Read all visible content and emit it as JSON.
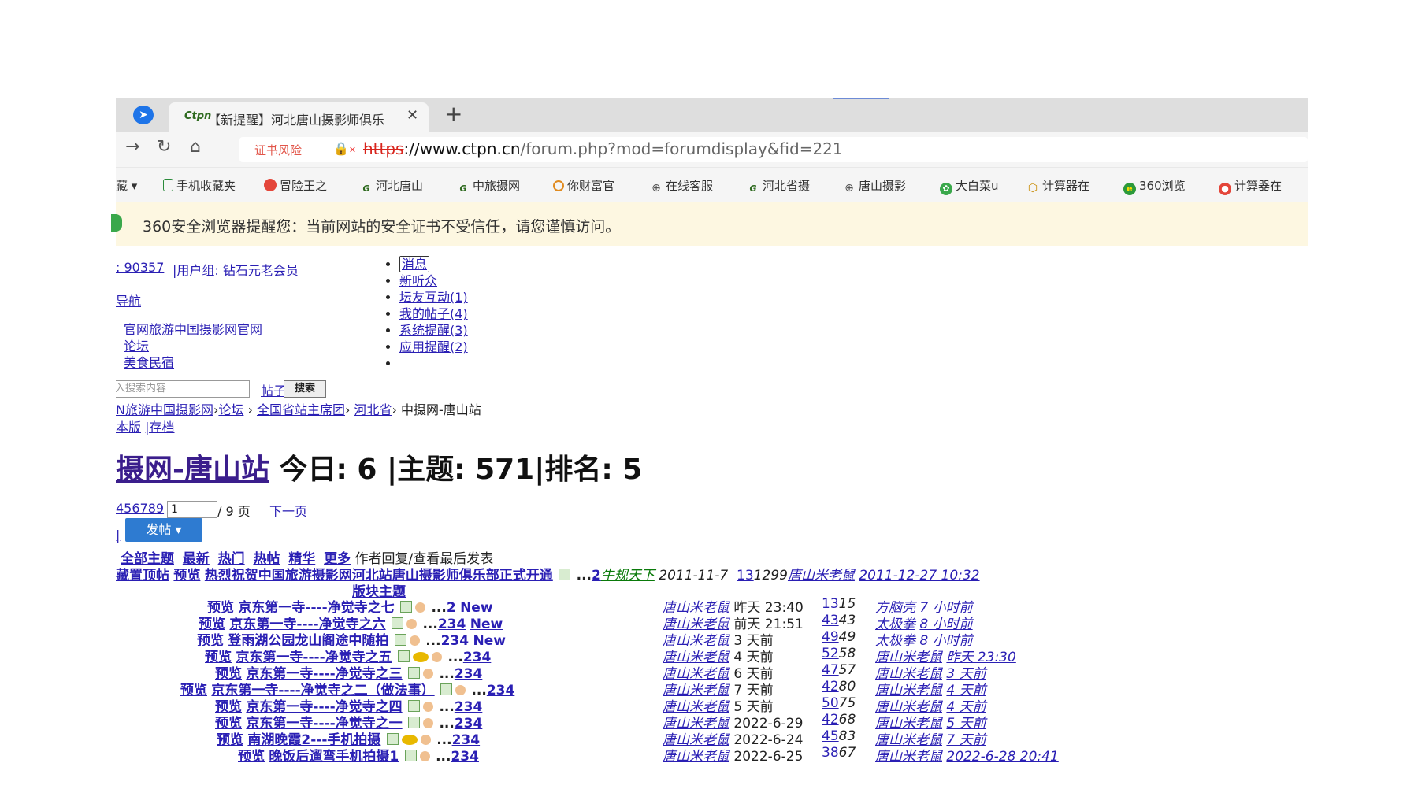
{
  "browser": {
    "tab": {
      "title": "【新提醒】河北唐山摄影师俱乐",
      "favicon": "Ctpn"
    },
    "address": {
      "cert_warning": "证书风险",
      "scheme": "https",
      "host": "://www.ctpn.cn",
      "path": "/forum.php?mod=forumdisplay&fid=221"
    },
    "bookmarks": [
      {
        "label": "藏",
        "icon": "none"
      },
      {
        "label": "手机收藏夹",
        "icon": "phone-icon"
      },
      {
        "label": "冒险王之",
        "icon": "pin-icon"
      },
      {
        "label": "河北唐山",
        "icon": "ctpn-icon"
      },
      {
        "label": "中旅摄网",
        "icon": "ctpn-icon"
      },
      {
        "label": "你财富官",
        "icon": "circle-icon"
      },
      {
        "label": "在线客服",
        "icon": "globe-icon"
      },
      {
        "label": "河北省摄",
        "icon": "ctpn-icon"
      },
      {
        "label": "唐山摄影",
        "icon": "globe-icon"
      },
      {
        "label": "大白菜u",
        "icon": "leaf-icon"
      },
      {
        "label": "计算器在",
        "icon": "hex-icon"
      },
      {
        "label": "360浏览",
        "icon": "360-icon"
      },
      {
        "label": "计算器在",
        "icon": "apple-icon"
      }
    ],
    "security_warning": "360安全浏览器提醒您：当前网站的安全证书不受信任，请您谨慎访问。"
  },
  "user": {
    "id_fragment": ": 90357",
    "group": "|用户组: 钻石元老会员",
    "nav": "导航",
    "links": [
      "官网旅游中国摄影网官网",
      "论坛",
      "美食民宿"
    ]
  },
  "messages": {
    "items": [
      "消息",
      "新听众",
      "坛友互动(1)",
      "我的帖子(4)",
      "系统提醒(3)",
      "应用提醒(2)",
      ""
    ]
  },
  "search": {
    "placeholder": "入搜索内容",
    "scope": "帖子",
    "button": "搜索"
  },
  "breadcrumb": {
    "items": [
      "N旅游中国摄影网",
      "论坛",
      "全国省站主席团",
      "河北省"
    ],
    "current": "中摄网-唐山站",
    "modes": [
      "本版",
      "|存档"
    ]
  },
  "forum": {
    "name": "摄网-唐山站",
    "stats": " 今日: 6 |主题: 571|排名: 5"
  },
  "pager": {
    "pages": "456789",
    "current": "1",
    "total": " / 9 页",
    "next": "下一页"
  },
  "post_button": "发帖",
  "filters": {
    "items": [
      "全部主题",
      "最新",
      "热门",
      "热帖",
      "精华",
      "更多"
    ],
    "columns": "作者回复/查看最后发表"
  },
  "sticky": {
    "prefix": "藏置顶帖",
    "preview": "预览",
    "title": "热烈祝贺中国旅游摄影网河北站唐山摄影师俱乐部正式开通",
    "pages": "2",
    "author": "牛规天下",
    "date": "2011-11-7",
    "replies": "13",
    "views": "1299",
    "last_author": "唐山米老鼠",
    "last_time": "2011-12-27 10:32"
  },
  "section_label": "版块主题",
  "threads": [
    {
      "preview": "预览",
      "title": "京东第一寺----净觉寺之七",
      "pages": "2",
      "new": "New",
      "author": "唐山米老鼠",
      "time": "昨天 23:40",
      "replies": "13",
      "views": "15",
      "last_author": "方脑壳",
      "last_time": "7 小时前"
    },
    {
      "preview": "预览",
      "title": "京东第一寺----净觉寺之六",
      "pages": "234",
      "new": "New",
      "author": "唐山米老鼠",
      "time": "前天 21:51",
      "replies": "43",
      "views": "43",
      "last_author": "太极拳",
      "last_time": "8 小时前"
    },
    {
      "preview": "预览",
      "title": "登雨湖公园龙山阁途中随拍",
      "pages": "234",
      "new": "New",
      "author": "唐山米老鼠",
      "time": "3 天前",
      "replies": "49",
      "views": "49",
      "last_author": "太极拳",
      "last_time": "8 小时前"
    },
    {
      "preview": "预览",
      "title": "京东第一寺----净觉寺之五",
      "pages": "234",
      "new": "",
      "author": "唐山米老鼠",
      "time": "4 天前",
      "replies": "52",
      "views": "58",
      "last_author": "唐山米老鼠",
      "last_time": "昨天 23:30"
    },
    {
      "preview": "预览",
      "title": "京东第一寺----净觉寺之三",
      "pages": "234",
      "new": "",
      "author": "唐山米老鼠",
      "time": "6 天前",
      "replies": "47",
      "views": "57",
      "last_author": "唐山米老鼠",
      "last_time": "3 天前"
    },
    {
      "preview": "预览",
      "title": "京东第一寺----净觉寺之二（做法事）",
      "pages": "234",
      "new": "",
      "author": "唐山米老鼠",
      "time": "7 天前",
      "replies": "42",
      "views": "80",
      "last_author": "唐山米老鼠",
      "last_time": "4 天前"
    },
    {
      "preview": "预览",
      "title": "京东第一寺----净觉寺之四",
      "pages": "234",
      "new": "",
      "author": "唐山米老鼠",
      "time": "5 天前",
      "replies": "50",
      "views": "75",
      "last_author": "唐山米老鼠",
      "last_time": "4 天前"
    },
    {
      "preview": "预览",
      "title": "京东第一寺----净觉寺之一",
      "pages": "234",
      "new": "",
      "author": "唐山米老鼠",
      "time": "2022-6-29",
      "replies": "42",
      "views": "68",
      "last_author": "唐山米老鼠",
      "last_time": "5 天前"
    },
    {
      "preview": "预览",
      "title": "南湖晚霞2---手机拍摄",
      "pages": "234",
      "new": "",
      "author": "唐山米老鼠",
      "time": "2022-6-24",
      "replies": "45",
      "views": "83",
      "last_author": "唐山米老鼠",
      "last_time": "7 天前"
    },
    {
      "preview": "预览",
      "title": "晚饭后遛弯手机拍摄1",
      "pages": "234",
      "new": "",
      "author": "唐山米老鼠",
      "time": "2022-6-25",
      "replies": "38",
      "views": "67",
      "last_author": "唐山米老鼠",
      "last_time": "2022-6-28 20:41"
    }
  ]
}
